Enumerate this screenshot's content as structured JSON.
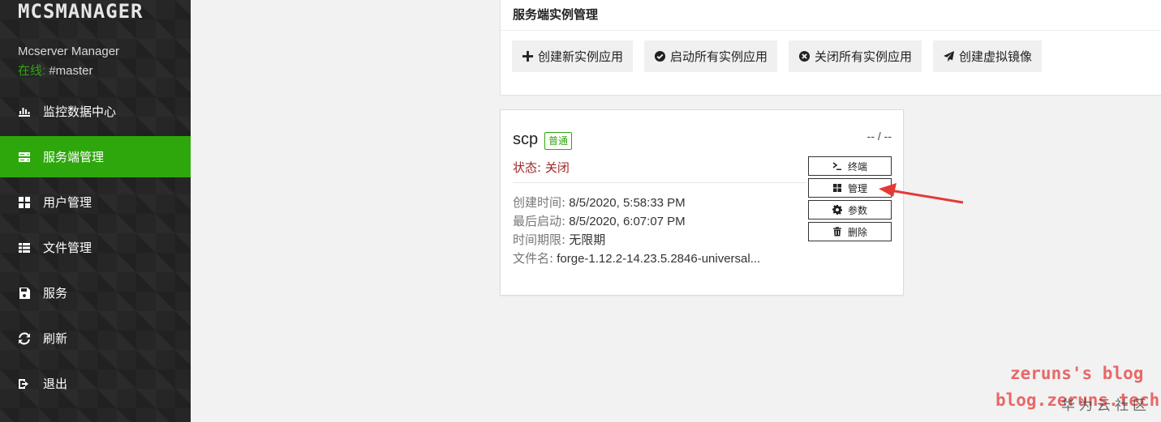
{
  "sidebar": {
    "logo": "MCSMANAGER",
    "brand_name": "Mcserver Manager",
    "status_label": "在线:",
    "status_value": " #master",
    "items": [
      {
        "label": "监控数据中心",
        "icon": "bar-chart-icon"
      },
      {
        "label": "服务端管理",
        "icon": "server-icon",
        "active": true
      },
      {
        "label": "用户管理",
        "icon": "grid-icon"
      },
      {
        "label": "文件管理",
        "icon": "list-icon"
      },
      {
        "label": "服务",
        "icon": "save-icon"
      },
      {
        "label": "刷新",
        "icon": "refresh-icon"
      },
      {
        "label": "退出",
        "icon": "logout-icon"
      }
    ]
  },
  "panel": {
    "title": "服务端实例管理",
    "buttons": {
      "create": "创建新实例应用",
      "start_all": "启动所有实例应用",
      "stop_all": "关闭所有实例应用",
      "create_image": "创建虚拟镜像"
    }
  },
  "instance": {
    "name": "scp",
    "tag": "普通",
    "status": "状态: 关闭",
    "usage": "-- / --",
    "created_label": "创建时间:",
    "created_value": " 8/5/2020, 5:58:33 PM",
    "last_start_label": "最后启动:",
    "last_start_value": " 8/5/2020, 6:07:07 PM",
    "expiry_label": "时间期限:",
    "expiry_value": " 无限期",
    "file_label": "文件名:",
    "file_value": " forge-1.12.2-14.23.5.2846-universal...",
    "actions": {
      "terminal": "终端",
      "manage": "管理",
      "params": "参数",
      "delete": "删除"
    }
  },
  "watermark": {
    "line1": "zeruns's blog",
    "line2": "blog.zeruns.tech",
    "line3": "华为云社区"
  },
  "colors": {
    "accent": "#2ea70c",
    "status_off": "#a02626",
    "arrow": "#e53935"
  }
}
